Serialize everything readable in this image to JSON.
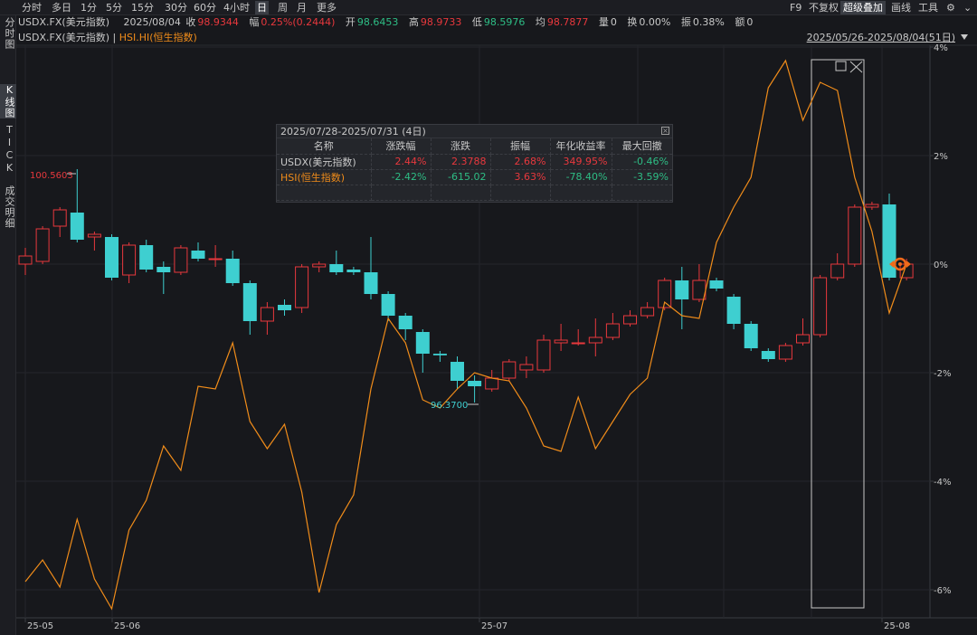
{
  "topbar": {
    "periods": [
      "分时",
      "多日",
      "1分",
      "5分",
      "15分",
      "30分",
      "60分",
      "4小时",
      "日",
      "周",
      "月",
      "更多"
    ],
    "active_period": "日",
    "right_tools": [
      "F9",
      "不复权",
      "超级叠加",
      "画线",
      "工具"
    ],
    "active_right_tool": "超级叠加",
    "settings_icon": "gear-icon"
  },
  "leftbar": {
    "tabs": [
      "分时图",
      "K线图",
      "TICK",
      "成交明细"
    ],
    "active_tab": "K线图"
  },
  "quote": {
    "symbol": "USDX.FX(美元指数)",
    "date": "2025/08/04",
    "close_label": "收",
    "close": "98.9344",
    "change_label": "幅",
    "change": "0.25%(0.2444)",
    "open_label": "开",
    "open": "98.6453",
    "high_label": "高",
    "high": "98.9733",
    "low_label": "低",
    "low": "98.5976",
    "avg_label": "均",
    "avg": "98.7877",
    "volume_label": "量",
    "volume": "0",
    "turnover_label": "换",
    "turnover": "0.00%",
    "amplitude_label": "振",
    "amplitude": "0.38%",
    "amount_label": "额",
    "amount": "0"
  },
  "legend": {
    "main": "USDX.FX(美元指数)",
    "separator": "|",
    "overlay": "HSI.HI(恒生指数)",
    "range": "2025/05/26-2025/08/04(51日)"
  },
  "stats": {
    "title": "2025/07/28-2025/07/31 (4日)",
    "headers": [
      "名称",
      "涨跌幅",
      "涨跌",
      "振幅",
      "年化收益率",
      "最大回撤"
    ],
    "rows": [
      {
        "name": "USDX(美元指数)",
        "pct": "2.44%",
        "chg": "2.3788",
        "amp": "2.68%",
        "annual": "349.95%",
        "dd": "-0.46%"
      },
      {
        "name": "HSI(恒生指数)",
        "pct": "-2.42%",
        "chg": "-615.02",
        "amp": "3.63%",
        "annual": "-78.40%",
        "dd": "-3.59%"
      }
    ]
  },
  "colors": {
    "up": "#e8383d",
    "down": "#3ecfd0",
    "overlay_line": "#f08c1a",
    "axis_text": "#c8c8c8",
    "background": "#17181c"
  },
  "chart_data": {
    "type": "candlestick",
    "x_ticks": [
      "25-05",
      "25-06",
      "25-07",
      "25-08"
    ],
    "y_ticks": [
      "4%",
      "2%",
      "0%",
      "-2%",
      "-4%",
      "-6%"
    ],
    "max_label": "100.5603",
    "min_label": "96.3700",
    "candles": [
      {
        "o": 0.0,
        "c": 0.15,
        "h": 0.3,
        "l": -0.2
      },
      {
        "o": 0.05,
        "c": 0.65,
        "h": 0.7,
        "l": 0.0
      },
      {
        "o": 0.7,
        "c": 1.0,
        "h": 1.05,
        "l": 0.5
      },
      {
        "o": 0.95,
        "c": 0.45,
        "h": 1.75,
        "l": 0.4
      },
      {
        "o": 0.5,
        "c": 0.55,
        "h": 0.6,
        "l": 0.25
      },
      {
        "o": 0.5,
        "c": -0.25,
        "h": 0.55,
        "l": -0.3
      },
      {
        "o": -0.2,
        "c": 0.35,
        "h": 0.4,
        "l": -0.35
      },
      {
        "o": 0.35,
        "c": -0.1,
        "h": 0.45,
        "l": -0.15
      },
      {
        "o": -0.05,
        "c": -0.15,
        "h": 0.05,
        "l": -0.55
      },
      {
        "o": -0.15,
        "c": 0.3,
        "h": 0.35,
        "l": -0.2
      },
      {
        "o": 0.25,
        "c": 0.1,
        "h": 0.4,
        "l": 0.05
      },
      {
        "o": 0.1,
        "c": 0.1,
        "h": 0.35,
        "l": -0.05
      },
      {
        "o": 0.1,
        "c": -0.35,
        "h": 0.25,
        "l": -0.4
      },
      {
        "o": -0.35,
        "c": -1.05,
        "h": -0.3,
        "l": -1.3
      },
      {
        "o": -1.05,
        "c": -0.8,
        "h": -0.7,
        "l": -1.3
      },
      {
        "o": -0.75,
        "c": -0.85,
        "h": -0.65,
        "l": -0.95
      },
      {
        "o": -0.8,
        "c": -0.05,
        "h": 0.0,
        "l": -0.9
      },
      {
        "o": -0.05,
        "c": 0.0,
        "h": 0.05,
        "l": -0.15
      },
      {
        "o": 0.0,
        "c": -0.15,
        "h": 0.25,
        "l": -0.2
      },
      {
        "o": -0.1,
        "c": -0.15,
        "h": -0.05,
        "l": -0.2
      },
      {
        "o": -0.15,
        "c": -0.55,
        "h": 0.5,
        "l": -0.65
      },
      {
        "o": -0.55,
        "c": -0.95,
        "h": -0.5,
        "l": -1.05
      },
      {
        "o": -0.95,
        "c": -1.2,
        "h": -0.9,
        "l": -1.4
      },
      {
        "o": -1.25,
        "c": -1.65,
        "h": -1.2,
        "l": -2.0
      },
      {
        "o": -1.65,
        "c": -1.68,
        "h": -1.6,
        "l": -1.8
      },
      {
        "o": -1.8,
        "c": -2.15,
        "h": -1.7,
        "l": -2.3
      },
      {
        "o": -2.15,
        "c": -2.25,
        "h": -2.05,
        "l": -2.55
      },
      {
        "o": -2.3,
        "c": -2.1,
        "h": -1.95,
        "l": -2.35
      },
      {
        "o": -2.1,
        "c": -1.8,
        "h": -1.75,
        "l": -2.15
      },
      {
        "o": -1.95,
        "c": -1.85,
        "h": -1.7,
        "l": -2.1
      },
      {
        "o": -1.95,
        "c": -1.4,
        "h": -1.3,
        "l": -2.0
      },
      {
        "o": -1.45,
        "c": -1.4,
        "h": -1.1,
        "l": -1.6
      },
      {
        "o": -1.45,
        "c": -1.45,
        "h": -1.2,
        "l": -1.5
      },
      {
        "o": -1.45,
        "c": -1.35,
        "h": -1.0,
        "l": -1.7
      },
      {
        "o": -1.35,
        "c": -1.1,
        "h": -0.9,
        "l": -1.4
      },
      {
        "o": -1.1,
        "c": -0.95,
        "h": -0.85,
        "l": -1.15
      },
      {
        "o": -0.95,
        "c": -0.8,
        "h": -0.7,
        "l": -1.0
      },
      {
        "o": -0.8,
        "c": -0.3,
        "h": -0.25,
        "l": -0.85
      },
      {
        "o": -0.3,
        "c": -0.65,
        "h": -0.05,
        "l": -1.2
      },
      {
        "o": -0.65,
        "c": -0.3,
        "h": 0.0,
        "l": -0.7
      },
      {
        "o": -0.3,
        "c": -0.45,
        "h": -0.25,
        "l": -0.5
      },
      {
        "o": -0.6,
        "c": -1.1,
        "h": -0.55,
        "l": -1.2
      },
      {
        "o": -1.1,
        "c": -1.55,
        "h": -1.05,
        "l": -1.6
      },
      {
        "o": -1.6,
        "c": -1.75,
        "h": -1.55,
        "l": -1.8
      },
      {
        "o": -1.75,
        "c": -1.5,
        "h": -1.45,
        "l": -1.8
      },
      {
        "o": -1.45,
        "c": -1.3,
        "h": -1.0,
        "l": -1.5
      },
      {
        "o": -1.3,
        "c": -0.25,
        "h": -0.2,
        "l": -1.35
      },
      {
        "o": -0.25,
        "c": 0.0,
        "h": 0.2,
        "l": -0.3
      },
      {
        "o": 0.0,
        "c": 1.05,
        "h": 1.1,
        "l": -0.05
      },
      {
        "o": 1.05,
        "c": 1.1,
        "h": 1.15,
        "l": 1.0
      },
      {
        "o": 1.1,
        "c": -0.25,
        "h": 1.3,
        "l": -0.3
      },
      {
        "o": -0.25,
        "c": 0.0,
        "h": 0.1,
        "l": -0.3
      }
    ],
    "hsi_line": [
      -5.85,
      -5.45,
      -5.95,
      -4.7,
      -5.8,
      -6.35,
      -4.9,
      -4.35,
      -3.35,
      -3.8,
      -2.25,
      -2.3,
      -1.45,
      -2.9,
      -3.4,
      -2.95,
      -4.2,
      -6.05,
      -4.8,
      -4.25,
      -2.3,
      -1.0,
      -1.45,
      -2.5,
      -2.65,
      -2.3,
      -2.0,
      -2.1,
      -2.15,
      -2.65,
      -3.35,
      -3.45,
      -2.45,
      -3.4,
      -2.9,
      -2.4,
      -2.1,
      -0.7,
      -0.95,
      -1.0,
      0.4,
      1.05,
      1.6,
      3.25,
      3.75,
      2.65,
      3.35,
      3.2,
      1.6,
      0.6,
      -0.9,
      0.0
    ]
  }
}
